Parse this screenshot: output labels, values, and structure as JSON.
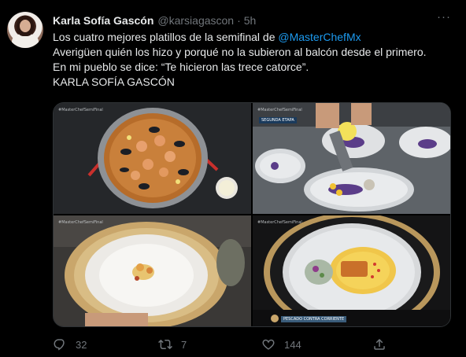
{
  "author": {
    "name": "Karla Sofía Gascón",
    "handle": "@karsiagascon",
    "separator": "·",
    "time": "5h"
  },
  "more_label": "···",
  "tweet": {
    "line1_prefix": "Los cuatro mejores platillos de la semifinal de ",
    "line1_mention": "@MasterChefMx",
    "line2": "Averigüen quién los hizo y porqué no la subieron al balcón desde el primero.",
    "line3": "En mi pueblo se dice: “Te hicieron las trece catorce”.",
    "line4": "KARLA SOFÍA GASCÓN"
  },
  "media": {
    "images": [
      {
        "watermark": "#MasterChefSemiFinal"
      },
      {
        "watermark": "#MasterChefSemiFinal",
        "badge": "SEGUNDA ETAPA"
      },
      {
        "watermark": "#MasterChefSemiFinal"
      },
      {
        "watermark": "#MasterChefSemiFinal",
        "badge": "PESCADO CONTRA CORRIENTE"
      }
    ]
  },
  "actions": {
    "reply": {
      "icon": "reply-icon",
      "count": "32"
    },
    "retweet": {
      "icon": "retweet-icon",
      "count": "7"
    },
    "like": {
      "icon": "heart-icon",
      "count": "144"
    },
    "share": {
      "icon": "share-icon"
    }
  },
  "colors": {
    "background": "#000000",
    "text": "#e7e9ea",
    "muted": "#71767b",
    "link": "#1d9bf0"
  }
}
